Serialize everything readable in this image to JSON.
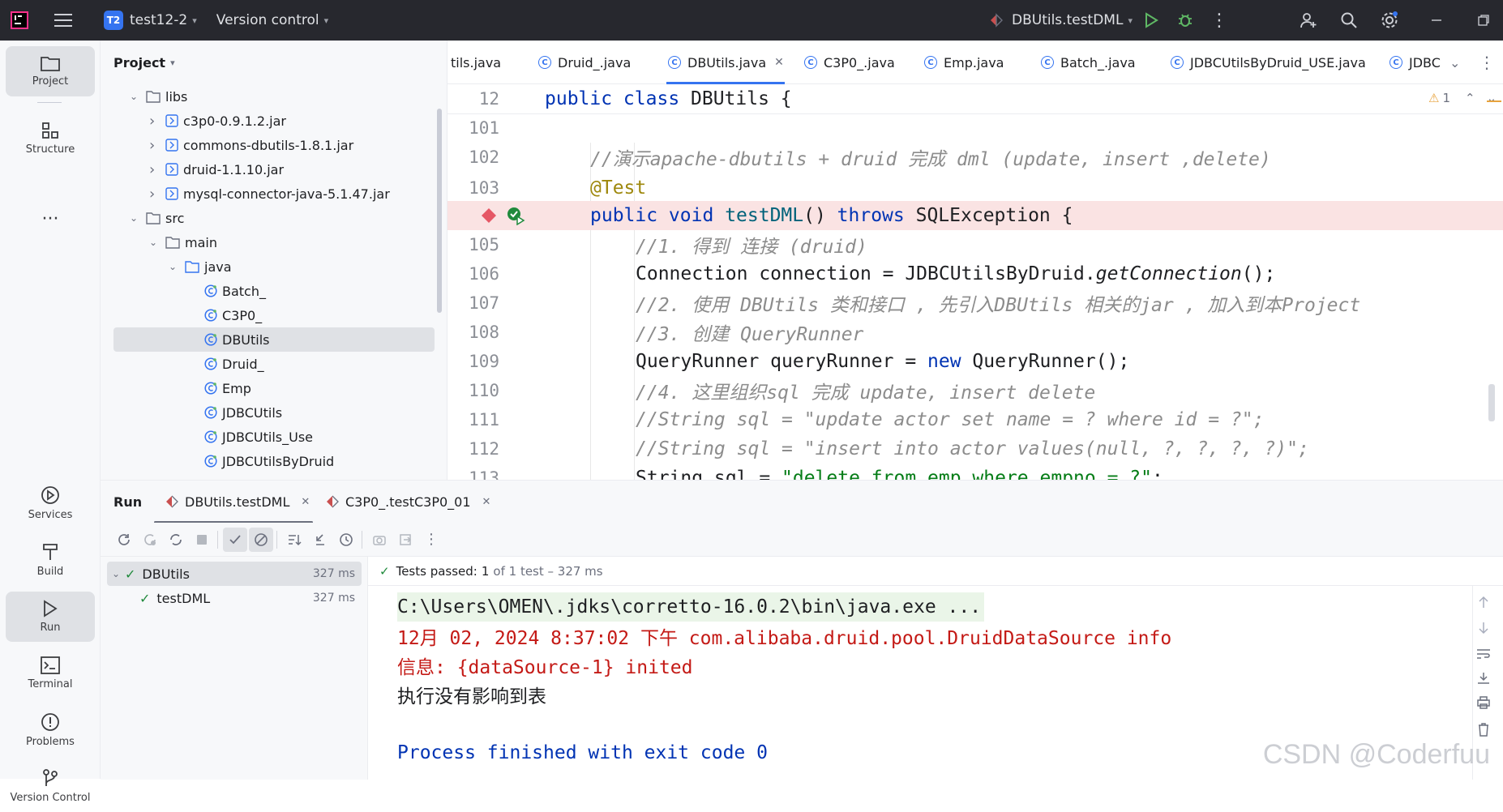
{
  "titlebar": {
    "project_badge": "T2",
    "project_name": "test12-2",
    "vcs": "Version control",
    "run_config": "DBUtils.testDML"
  },
  "toolstrip": {
    "project": "Project",
    "structure": "Structure",
    "services": "Services",
    "build": "Build",
    "run": "Run",
    "terminal": "Terminal",
    "problems": "Problems",
    "version_control": "Version Control"
  },
  "project_panel": {
    "title": "Project",
    "tree": [
      {
        "label": "libs",
        "kind": "folder",
        "expanded": true
      },
      {
        "label": "c3p0-0.9.1.2.jar",
        "kind": "jar"
      },
      {
        "label": "commons-dbutils-1.8.1.jar",
        "kind": "jar"
      },
      {
        "label": "druid-1.1.10.jar",
        "kind": "jar"
      },
      {
        "label": "mysql-connector-java-5.1.47.jar",
        "kind": "jar"
      },
      {
        "label": "src",
        "kind": "folder",
        "expanded": true
      },
      {
        "label": "main",
        "kind": "folder",
        "expanded": true
      },
      {
        "label": "java",
        "kind": "folder",
        "expanded": true
      },
      {
        "label": "Batch_",
        "kind": "class"
      },
      {
        "label": "C3P0_",
        "kind": "class"
      },
      {
        "label": "DBUtils",
        "kind": "class",
        "selected": true
      },
      {
        "label": "Druid_",
        "kind": "class"
      },
      {
        "label": "Emp",
        "kind": "class"
      },
      {
        "label": "JDBCUtils",
        "kind": "class"
      },
      {
        "label": "JDBCUtils_Use",
        "kind": "class"
      },
      {
        "label": "JDBCUtilsByDruid",
        "kind": "class"
      }
    ]
  },
  "editor": {
    "tabs": [
      "tils.java",
      "Druid_.java",
      "DBUtils.java",
      "C3P0_.java",
      "Emp.java",
      "Batch_.java",
      "JDBCUtilsByDruid_USE.java",
      "JDBC"
    ],
    "active_tab": "DBUtils.java",
    "warnings": "1",
    "sticky_line": {
      "number": "12",
      "text_kw": "public class",
      "text_rest": " DBUtils {"
    },
    "lines": [
      {
        "number": "101"
      },
      {
        "number": "102",
        "comment": "//演示apache-dbutils + druid 完成 dml (update, insert ,delete)"
      },
      {
        "number": "103",
        "annotation": "@Test"
      },
      {
        "number": "",
        "kw1": "public void",
        "method": "testDML",
        "mid": "() ",
        "kw2": "throws",
        "rest": " SQLException {"
      },
      {
        "number": "105",
        "comment": "//1. 得到 连接 (druid)"
      },
      {
        "number": "106",
        "pre": "Connection connection = JDBCUtilsByDruid.",
        "italic": "getConnection",
        "post": "();"
      },
      {
        "number": "107",
        "comment": "//2. 使用 DBUtils 类和接口 , 先引入DBUtils 相关的jar , 加入到本Project"
      },
      {
        "number": "108",
        "comment": "//3. 创建 QueryRunner"
      },
      {
        "number": "109",
        "pre": "QueryRunner queryRunner = ",
        "kw": "new",
        "post": " QueryRunner();"
      },
      {
        "number": "110",
        "comment": "//4. 这里组织sql 完成 update, insert delete"
      },
      {
        "number": "111",
        "comment": "//String sql = \"update actor set name = ? where id = ?\";"
      },
      {
        "number": "112",
        "comment": "//String sql = \"insert into actor values(null, ?, ?, ?, ?)\";"
      },
      {
        "number": "113",
        "pre": "String sql = ",
        "string": "\"delete from emp where empno = ?\"",
        "post": ";"
      }
    ]
  },
  "run_window": {
    "title": "Run",
    "tabs": [
      "DBUtils.testDML",
      "C3P0_.testC3P0_01"
    ],
    "tests": [
      {
        "name": "DBUtils",
        "time": "327 ms"
      },
      {
        "name": "testDML",
        "time": "327 ms"
      }
    ],
    "status_prefix": "Tests passed:",
    "status_count": "1",
    "status_suffix": "of 1 test – 327 ms",
    "console": [
      {
        "text": "C:\\Users\\OMEN\\.jdks\\corretto-16.0.2\\bin\\java.exe ...",
        "color": "#1e1f22"
      },
      {
        "text": "12月 02, 2024 8:37:02 下午 com.alibaba.druid.pool.DruidDataSource info",
        "color": "#c41a16"
      },
      {
        "text": "信息: {dataSource-1} inited",
        "color": "#c41a16"
      },
      {
        "text": "执行没有影响到表",
        "color": "#1e1f22"
      },
      {
        "text": "",
        "color": "#1e1f22"
      },
      {
        "text": "Process finished with exit code 0",
        "color": "#0033b3"
      }
    ]
  },
  "watermark": "CSDN @Coderfuu",
  "colors": {
    "accent": "#3574f0",
    "pass": "#208a3c",
    "error": "#c41a16"
  }
}
